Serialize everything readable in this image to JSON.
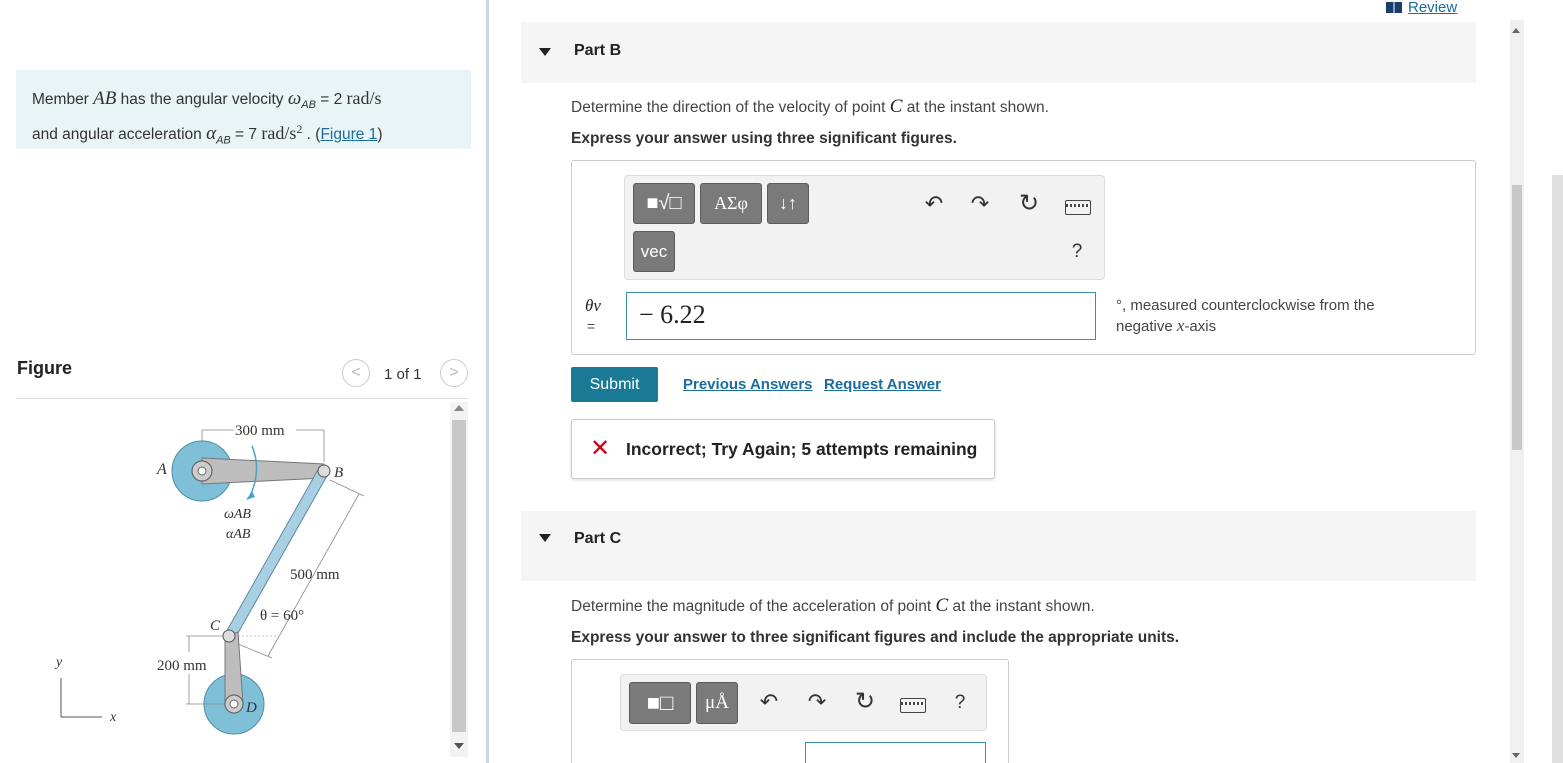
{
  "problem": {
    "text_1": "Member ",
    "sym_AB": "AB",
    "text_2": " has the angular velocity ",
    "omega": "ω",
    "omega_sub": "AB",
    "omega_value": " = 2 ",
    "omega_unit": "rad/s",
    "text_3": "and angular acceleration ",
    "alpha": "α",
    "alpha_sub": "AB",
    "alpha_value": " = 7 ",
    "alpha_unit": "rad/s",
    "alpha_unit_exp": "2",
    "text_4": " . (",
    "figure_link": "Figure 1",
    "text_5": ")"
  },
  "figure": {
    "title": "Figure",
    "counter": "1 of 1",
    "prev_glyph": "<",
    "next_glyph": ">",
    "labels": {
      "dim_top": "300 mm",
      "point_a": "A",
      "point_b": "B",
      "point_c": "C",
      "point_d": "D",
      "omega_ab": "ωAB",
      "alpha_ab": "αAB",
      "dim_link": "500 mm",
      "theta": "θ = 60°",
      "dim_bottom": "200 mm",
      "axis_y": "y",
      "axis_x": "x"
    },
    "colors": {
      "disk": "#7fbfd8",
      "link": "#a9cfe2",
      "arm": "#bdbdbd"
    }
  },
  "header": {
    "review_label": "Review"
  },
  "part_b": {
    "title": "Part B",
    "question_1": "Determine the direction of the velocity of point ",
    "question_sym": "C",
    "question_2": " at the instant shown.",
    "instruction": "Express your answer using three significant figures.",
    "toolbar": {
      "templates_label": "■√□",
      "greek_label": "ΑΣφ",
      "sort_label": "↓↑",
      "vec_label": "vec",
      "undo_glyph": "↶",
      "redo_glyph": "↷",
      "reset_glyph": "↻",
      "help_label": "?"
    },
    "var_label": "θv",
    "var_eq": "=",
    "answer_value": "− 6.22",
    "unit_1": "°, measured counterclockwise from the",
    "unit_2": "negative ",
    "unit_sym": "x",
    "unit_3": "-axis",
    "submit_label": "Submit",
    "previous_answers_label": "Previous Answers",
    "request_answer_label": "Request Answer",
    "feedback_icon": "✕",
    "feedback": "Incorrect; Try Again; 5 attempts remaining"
  },
  "part_c": {
    "title": "Part C",
    "question_1": "Determine the magnitude of the acceleration of point ",
    "question_sym": "C",
    "question_2": " at the instant shown.",
    "instruction": "Express your answer to three significant figures and include the appropriate units.",
    "toolbar": {
      "templates_label": "■□",
      "units_label": "μÅ",
      "undo_glyph": "↶",
      "redo_glyph": "↷",
      "reset_glyph": "↻",
      "help_label": "?"
    }
  },
  "colors": {
    "accent": "#1a7a96",
    "link": "#1a6d9c",
    "problem_bg": "#e8f4f6",
    "error": "#d0021b",
    "part_header_bg": "#f5f5f5"
  }
}
